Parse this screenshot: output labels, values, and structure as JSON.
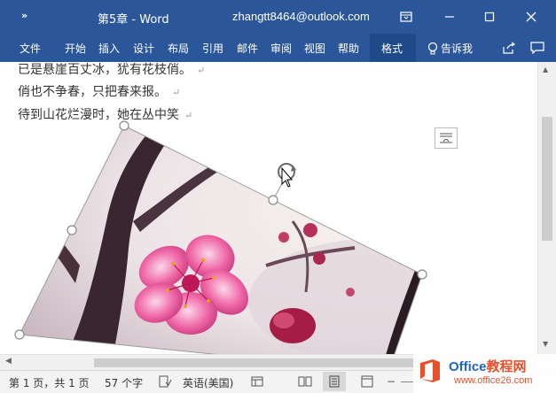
{
  "titlebar": {
    "qat_label": "»",
    "doc_title": "第5章 - Word",
    "account": "zhangtt8464@outlook.com"
  },
  "ribbon": {
    "tabs": [
      "文件",
      "开始",
      "插入",
      "设计",
      "布局",
      "引用",
      "邮件",
      "审阅",
      "视图",
      "帮助"
    ],
    "format_tab": "格式",
    "tell_me": "告诉我"
  },
  "document": {
    "lines": [
      "已是悬崖百丈冰，犹有花枝俏。",
      "俏也不争春，只把春来报。",
      "待到山花烂漫时，她在丛中笑"
    ],
    "para_mark": "↵"
  },
  "statusbar": {
    "page": "第 1 页，共 1 页",
    "words": "57 个字",
    "language": "英语(美国)"
  },
  "watermark": {
    "brand_latin": "Office",
    "brand_cn": "教程网",
    "url": "www.office26.com"
  },
  "colors": {
    "word_blue": "#2b579a",
    "format_tab_blue": "#1e4a8a",
    "office_orange": "#e8502a"
  }
}
